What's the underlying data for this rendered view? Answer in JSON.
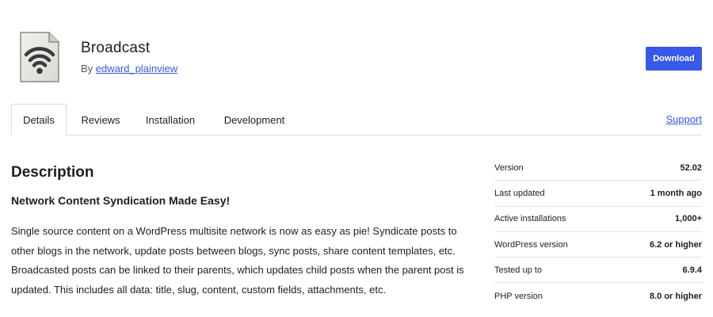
{
  "plugin": {
    "name": "Broadcast",
    "by_prefix": "By",
    "author": "edward_plainview",
    "icon": "wifi-document-icon"
  },
  "actions": {
    "download_label": "Download"
  },
  "tabs": [
    {
      "label": "Details",
      "active": true
    },
    {
      "label": "Reviews",
      "active": false
    },
    {
      "label": "Installation",
      "active": false
    },
    {
      "label": "Development",
      "active": false
    }
  ],
  "support_label": "Support",
  "description": {
    "heading": "Description",
    "subheading": "Network Content Syndication Made Easy!",
    "paragraph": "Single source content on a WordPress multisite network is now as easy as pie! Syndicate posts to other blogs in the network, update posts between blogs, sync posts, share content templates, etc. Broadcasted posts can be linked to their parents, which updates child posts when the parent post is updated. This includes all data: title, slug, content, custom fields, attachments, etc."
  },
  "meta": [
    {
      "label": "Version",
      "value": "52.02"
    },
    {
      "label": "Last updated",
      "value": "1 month ago"
    },
    {
      "label": "Active installations",
      "value": "1,000+"
    },
    {
      "label": "WordPress version",
      "value": "6.2 or higher"
    },
    {
      "label": "Tested up to",
      "value": "6.9.4"
    },
    {
      "label": "PHP version",
      "value": "8.0 or higher"
    }
  ],
  "colors": {
    "accent": "#3858e9",
    "text": "#1e1e1e",
    "border": "#dcdcde"
  }
}
